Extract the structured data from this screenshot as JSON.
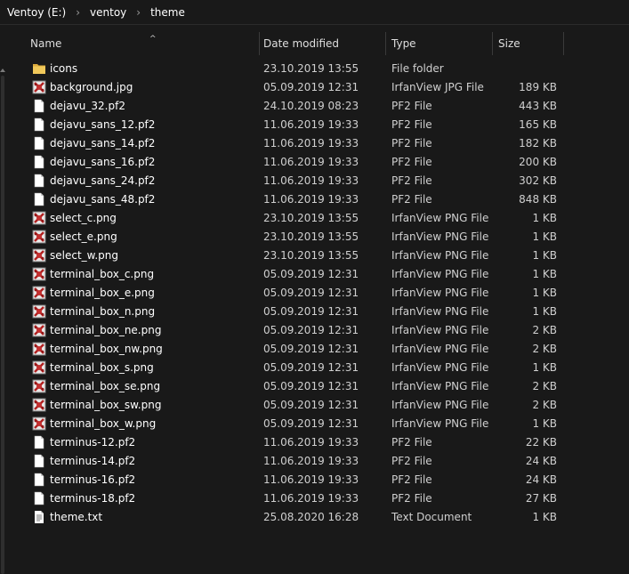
{
  "breadcrumb": [
    "Ventoy (E:)",
    "ventoy",
    "theme"
  ],
  "columns": {
    "name": "Name",
    "date": "Date modified",
    "type": "Type",
    "size": "Size"
  },
  "colors": {
    "background": "#191919",
    "folder": "#e8b84a",
    "irfan_red": "#b02020"
  },
  "files": [
    {
      "name": "icons",
      "date": "23.10.2019 13:55",
      "type": "File folder",
      "size": "",
      "icon": "folder-icon"
    },
    {
      "name": "background.jpg",
      "date": "05.09.2019 12:31",
      "type": "IrfanView JPG File",
      "size": "189 KB",
      "icon": "irfanview-image-icon"
    },
    {
      "name": "dejavu_32.pf2",
      "date": "24.10.2019 08:23",
      "type": "PF2 File",
      "size": "443 KB",
      "icon": "blank-file-icon"
    },
    {
      "name": "dejavu_sans_12.pf2",
      "date": "11.06.2019 19:33",
      "type": "PF2 File",
      "size": "165 KB",
      "icon": "blank-file-icon"
    },
    {
      "name": "dejavu_sans_14.pf2",
      "date": "11.06.2019 19:33",
      "type": "PF2 File",
      "size": "182 KB",
      "icon": "blank-file-icon"
    },
    {
      "name": "dejavu_sans_16.pf2",
      "date": "11.06.2019 19:33",
      "type": "PF2 File",
      "size": "200 KB",
      "icon": "blank-file-icon"
    },
    {
      "name": "dejavu_sans_24.pf2",
      "date": "11.06.2019 19:33",
      "type": "PF2 File",
      "size": "302 KB",
      "icon": "blank-file-icon"
    },
    {
      "name": "dejavu_sans_48.pf2",
      "date": "11.06.2019 19:33",
      "type": "PF2 File",
      "size": "848 KB",
      "icon": "blank-file-icon"
    },
    {
      "name": "select_c.png",
      "date": "23.10.2019 13:55",
      "type": "IrfanView PNG File",
      "size": "1 KB",
      "icon": "irfanview-image-icon"
    },
    {
      "name": "select_e.png",
      "date": "23.10.2019 13:55",
      "type": "IrfanView PNG File",
      "size": "1 KB",
      "icon": "irfanview-image-icon"
    },
    {
      "name": "select_w.png",
      "date": "23.10.2019 13:55",
      "type": "IrfanView PNG File",
      "size": "1 KB",
      "icon": "irfanview-image-icon"
    },
    {
      "name": "terminal_box_c.png",
      "date": "05.09.2019 12:31",
      "type": "IrfanView PNG File",
      "size": "1 KB",
      "icon": "irfanview-image-icon"
    },
    {
      "name": "terminal_box_e.png",
      "date": "05.09.2019 12:31",
      "type": "IrfanView PNG File",
      "size": "1 KB",
      "icon": "irfanview-image-icon"
    },
    {
      "name": "terminal_box_n.png",
      "date": "05.09.2019 12:31",
      "type": "IrfanView PNG File",
      "size": "1 KB",
      "icon": "irfanview-image-icon"
    },
    {
      "name": "terminal_box_ne.png",
      "date": "05.09.2019 12:31",
      "type": "IrfanView PNG File",
      "size": "2 KB",
      "icon": "irfanview-image-icon"
    },
    {
      "name": "terminal_box_nw.png",
      "date": "05.09.2019 12:31",
      "type": "IrfanView PNG File",
      "size": "2 KB",
      "icon": "irfanview-image-icon"
    },
    {
      "name": "terminal_box_s.png",
      "date": "05.09.2019 12:31",
      "type": "IrfanView PNG File",
      "size": "1 KB",
      "icon": "irfanview-image-icon"
    },
    {
      "name": "terminal_box_se.png",
      "date": "05.09.2019 12:31",
      "type": "IrfanView PNG File",
      "size": "2 KB",
      "icon": "irfanview-image-icon"
    },
    {
      "name": "terminal_box_sw.png",
      "date": "05.09.2019 12:31",
      "type": "IrfanView PNG File",
      "size": "2 KB",
      "icon": "irfanview-image-icon"
    },
    {
      "name": "terminal_box_w.png",
      "date": "05.09.2019 12:31",
      "type": "IrfanView PNG File",
      "size": "1 KB",
      "icon": "irfanview-image-icon"
    },
    {
      "name": "terminus-12.pf2",
      "date": "11.06.2019 19:33",
      "type": "PF2 File",
      "size": "22 KB",
      "icon": "blank-file-icon"
    },
    {
      "name": "terminus-14.pf2",
      "date": "11.06.2019 19:33",
      "type": "PF2 File",
      "size": "24 KB",
      "icon": "blank-file-icon"
    },
    {
      "name": "terminus-16.pf2",
      "date": "11.06.2019 19:33",
      "type": "PF2 File",
      "size": "24 KB",
      "icon": "blank-file-icon"
    },
    {
      "name": "terminus-18.pf2",
      "date": "11.06.2019 19:33",
      "type": "PF2 File",
      "size": "27 KB",
      "icon": "blank-file-icon"
    },
    {
      "name": "theme.txt",
      "date": "25.08.2020 16:28",
      "type": "Text Document",
      "size": "1 KB",
      "icon": "text-document-icon"
    }
  ]
}
